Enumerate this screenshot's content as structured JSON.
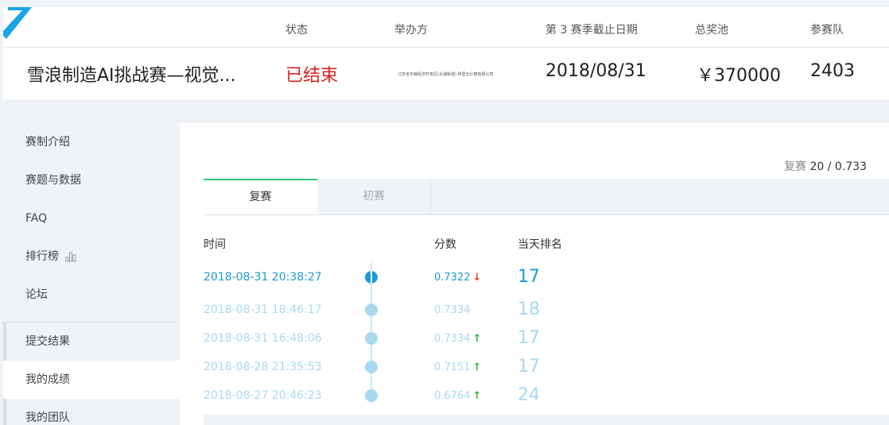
{
  "header": {
    "columns": {
      "status_label": "状态",
      "organizer_label": "举办方",
      "deadline_label": "第 3 赛季截止日期",
      "prize_label": "总奖池",
      "teams_label": "参赛队"
    },
    "competition_title": "雪浪制造AI挑战赛—视觉...",
    "status": "已结束",
    "organizer": "江苏省无锡经济开发区(太湖新城)  阿里云计算有限公司",
    "deadline": "2018/08/31",
    "prize_pool": "￥370000",
    "team_count": "2403"
  },
  "sidebar": {
    "items": [
      {
        "label": "赛制介绍"
      },
      {
        "label": "赛题与数据"
      },
      {
        "label": "FAQ"
      },
      {
        "label": "排行榜"
      },
      {
        "label": "论坛"
      },
      {
        "label": "提交结果"
      },
      {
        "label": "我的成绩"
      },
      {
        "label": "我的团队"
      }
    ]
  },
  "main": {
    "summary": {
      "stage": "复赛",
      "value": "20 / 0.733"
    },
    "tabs": [
      {
        "label": "复赛",
        "active": true
      },
      {
        "label": "初赛",
        "active": false
      }
    ],
    "table": {
      "headers": {
        "time": "时间",
        "score": "分数",
        "rank": "当天排名"
      },
      "rows": [
        {
          "time": "2018-08-31 20:38:27",
          "score": "0.7322",
          "trend": "down",
          "rank": "17"
        },
        {
          "time": "2018-08-31 18:46:17",
          "score": "0.7334",
          "trend": "",
          "rank": "18"
        },
        {
          "time": "2018-08-31 16:48:06",
          "score": "0.7334",
          "trend": "up",
          "rank": "17"
        },
        {
          "time": "2018-08-28 21:35:53",
          "score": "0.7151",
          "trend": "up",
          "rank": "17"
        },
        {
          "time": "2018-08-27 20:46:23",
          "score": "0.6764",
          "trend": "up",
          "rank": "24"
        }
      ]
    }
  },
  "colors": {
    "accent_blue": "#1a9ad8",
    "status_red": "#e02020",
    "tab_green": "#2ec37a",
    "up_green": "#2cb83a",
    "down_red": "#e04a1f"
  }
}
